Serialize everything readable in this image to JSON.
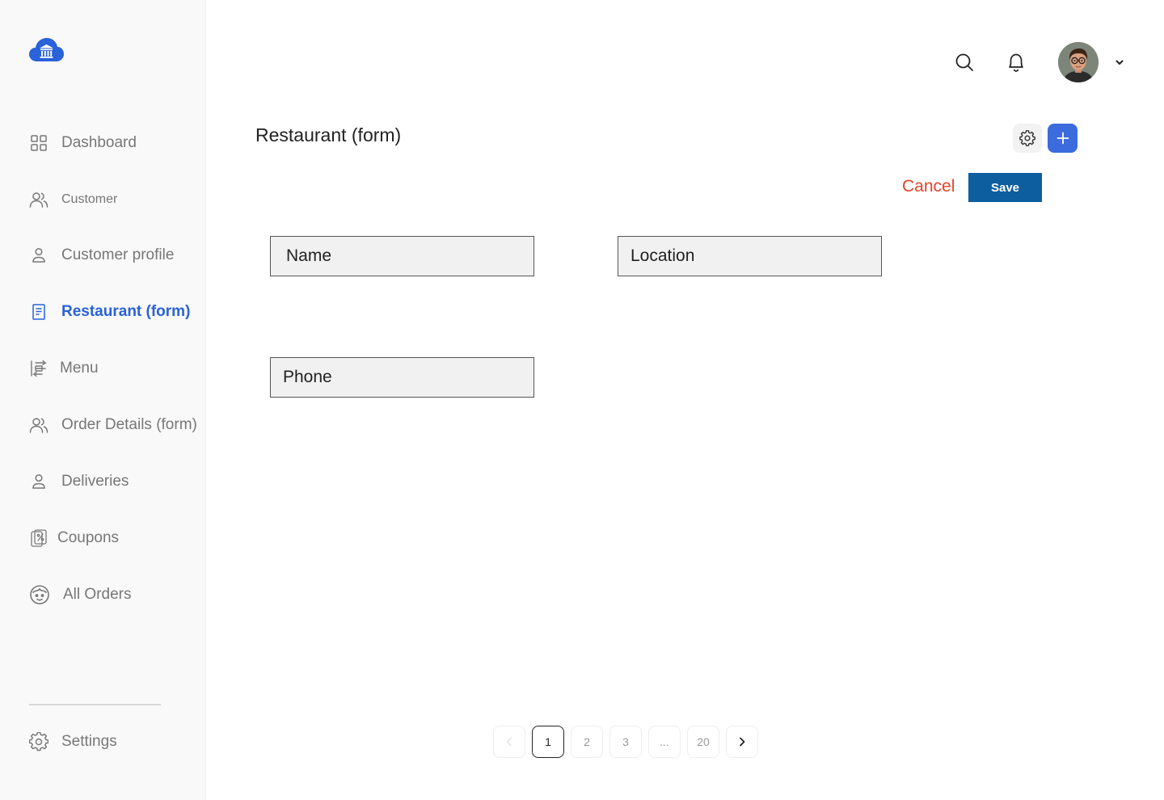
{
  "app": {
    "logo_icon": "cloud-bank-icon",
    "accent_color": "#2962d9"
  },
  "sidebar": {
    "items": [
      {
        "label": "Dashboard",
        "icon": "grid-icon"
      },
      {
        "label": "Customer",
        "icon": "users-icon"
      },
      {
        "label": "Customer profile",
        "icon": "user-icon"
      },
      {
        "label": "Restaurant (form)",
        "icon": "receipt-icon",
        "active": true
      },
      {
        "label": "Menu",
        "icon": "menu-transfer-icon"
      },
      {
        "label": "Order Details (form)",
        "icon": "users-icon"
      },
      {
        "label": "Deliveries",
        "icon": "user-icon"
      },
      {
        "label": "Coupons",
        "icon": "coupon-icon"
      },
      {
        "label": "All Orders",
        "icon": "face-icon"
      }
    ],
    "settings_label": "Settings"
  },
  "topbar": {
    "search_icon": "search-icon",
    "notification_icon": "bell-icon",
    "avatar_icon": "user-avatar",
    "dropdown_icon": "chevron-down-icon"
  },
  "main": {
    "title": "Restaurant (form)",
    "cancel_label": "Cancel",
    "save_label": "Save",
    "fields": {
      "name": "Name",
      "location": "Location",
      "phone": "Phone"
    }
  },
  "pagination": {
    "pages": [
      "1",
      "2",
      "3",
      "...",
      "20"
    ],
    "current": "1"
  }
}
